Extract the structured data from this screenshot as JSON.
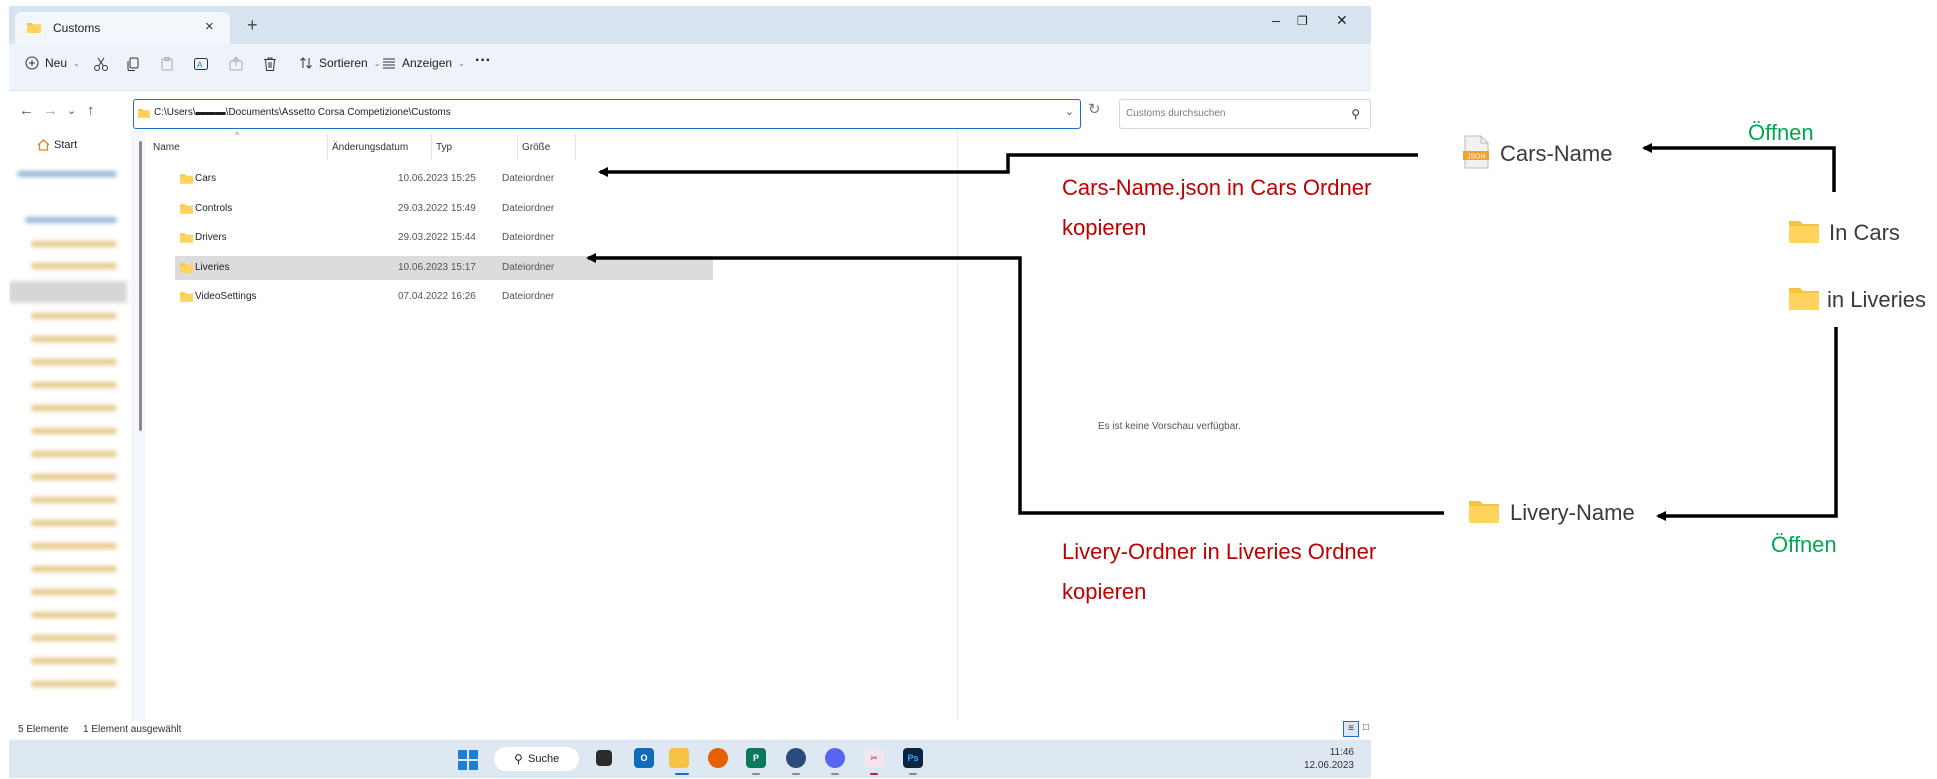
{
  "window": {
    "tab_title": "Customs",
    "new_tab": "+",
    "controls": {
      "minimize": "–",
      "maximize": "❐",
      "close": "✕"
    }
  },
  "toolbar": {
    "new_label": "Neu",
    "sort_label": "Sortieren",
    "view_label": "Anzeigen",
    "more_label": "···"
  },
  "address": {
    "path": "C:\\Users\\▬▬▬\\Documents\\Assetto Corsa Competizione\\Customs",
    "search_placeholder": "Customs durchsuchen"
  },
  "sidebar": {
    "start_label": "Start"
  },
  "columns": {
    "name": "Name",
    "date": "Änderungsdatum",
    "type": "Typ",
    "size": "Größe"
  },
  "files": [
    {
      "name": "Cars",
      "date": "10.06.2023 15:25",
      "type": "Dateiordner",
      "selected": false
    },
    {
      "name": "Controls",
      "date": "29.03.2022 15:49",
      "type": "Dateiordner",
      "selected": false
    },
    {
      "name": "Drivers",
      "date": "29.03.2022 15:44",
      "type": "Dateiordner",
      "selected": false
    },
    {
      "name": "Liveries",
      "date": "10.06.2023 15:17",
      "type": "Dateiordner",
      "selected": true
    },
    {
      "name": "VideoSettings",
      "date": "07.04.2022 16:26",
      "type": "Dateiordner",
      "selected": false
    }
  ],
  "preview": {
    "message": "Es ist keine Vorschau verfügbar."
  },
  "status": {
    "count": "5 Elemente",
    "selection": "1 Element ausgewählt"
  },
  "taskbar": {
    "search_label": "Suche",
    "time": "11:46",
    "date": "12.06.2023"
  },
  "annotations": {
    "cars_name_label": "Cars-Name",
    "cars_name_icon_text": "JSON",
    "oeffnen_top": "Öffnen",
    "in_cars": "In Cars",
    "in_liveries": "in Liveries",
    "livery_name": "Livery-Name",
    "oeffnen_bottom": "Öffnen",
    "cars_instruction_line1": "Cars-Name.json in Cars Ordner",
    "cars_instruction_line2": "kopieren",
    "livery_instruction_line1": "Livery-Ordner in Liveries Ordner",
    "livery_instruction_line2": "kopieren"
  },
  "colors": {
    "accent": "#1d6dc6",
    "instruction": "#c00000",
    "open_label": "#00a84f",
    "folder": "#f5c242"
  }
}
